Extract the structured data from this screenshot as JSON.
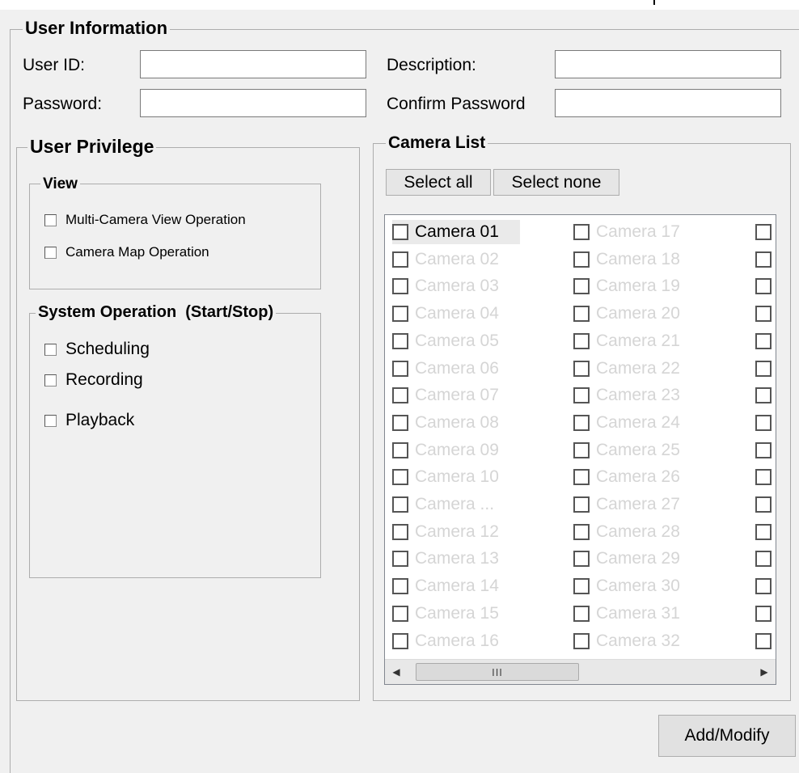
{
  "user_info": {
    "title": "User Information",
    "user_id_label": "User ID:",
    "user_id_value": "",
    "password_label": "Password:",
    "password_value": "",
    "description_label": "Description:",
    "description_value": "",
    "confirm_label": "Confirm Password",
    "confirm_value": ""
  },
  "privilege": {
    "title": "User Privilege",
    "view": {
      "title": "View",
      "items": [
        "Multi-Camera View Operation",
        "Camera Map Operation"
      ]
    },
    "system": {
      "title": "System Operation  (Start/Stop)",
      "items": [
        "Scheduling",
        "Recording",
        "Playback"
      ]
    }
  },
  "camera_list": {
    "title": "Camera List",
    "select_all": "Select all",
    "select_none": "Select none",
    "column1": [
      "Camera 01",
      "Camera 02",
      "Camera 03",
      "Camera 04",
      "Camera 05",
      "Camera 06",
      "Camera 07",
      "Camera 08",
      "Camera 09",
      "Camera 10",
      "Camera ...",
      "Camera 12",
      "Camera 13",
      "Camera 14",
      "Camera 15",
      "Camera 16"
    ],
    "column2": [
      "Camera 17",
      "Camera 18",
      "Camera 19",
      "Camera 20",
      "Camera 21",
      "Camera 22",
      "Camera 23",
      "Camera 24",
      "Camera 25",
      "Camera 26",
      "Camera 27",
      "Camera 28",
      "Camera 29",
      "Camera 30",
      "Camera 31",
      "Camera 32"
    ],
    "enabled": [
      "Camera 01"
    ],
    "scroll_thumb_grip": "III"
  },
  "add_modify_button": "Add/Modify",
  "colors": {
    "background": "#f0f0f0",
    "disabled_text": "#d5d5d5",
    "border": "#adadad"
  }
}
